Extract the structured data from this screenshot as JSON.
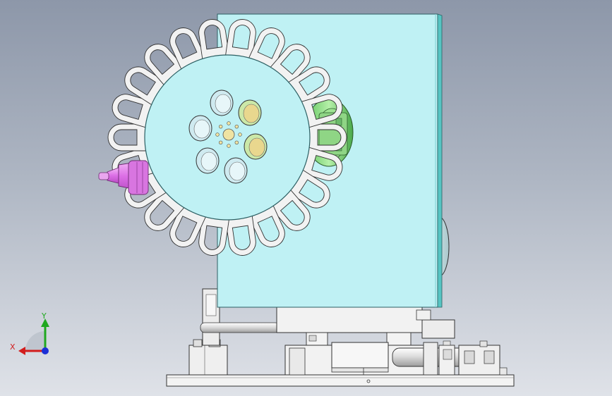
{
  "viewport": {
    "background_top": "#8d97a9",
    "background_bottom": "#dfe2e8"
  },
  "triad": {
    "x_label": "X",
    "y_label": "Y",
    "x_color": "#d21d1d",
    "y_color": "#1fa81f",
    "z_color": "#1c2fd6"
  },
  "colors": {
    "plate": "#bff1f4",
    "plate_edge": "#2c5f63",
    "metal": "#f1f1f1",
    "metal_shade": "#c9c9c9",
    "line": "#333333",
    "green": "#8ee28e",
    "pink": "#e789ee",
    "gold": "#efe3a2"
  }
}
